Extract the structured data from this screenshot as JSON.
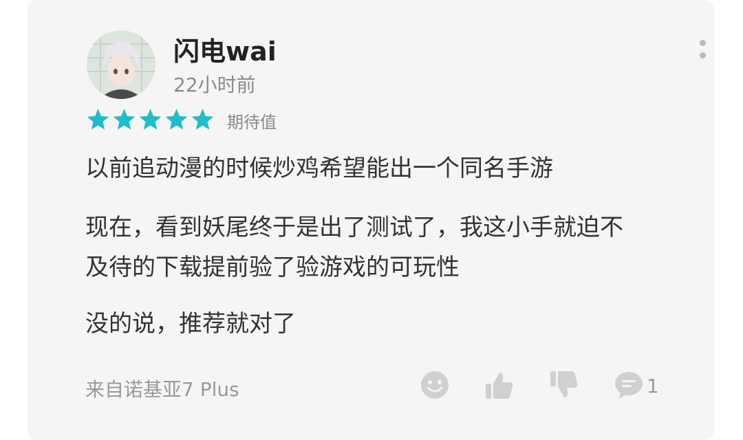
{
  "review": {
    "username": "闪电wai",
    "time": "22小时前",
    "rating": 5,
    "rating_max": 5,
    "rating_label": "期待值",
    "paragraphs": [
      [
        "以前追动漫的时候炒鸡希望能出一个同名手游"
      ],
      [
        "现在，看到妖尾终于是出了测试了，我这小手就迫不",
        "及待的下载提前验了验游戏的可玩性"
      ],
      [
        "没的说，推荐就对了"
      ]
    ],
    "device": "来自诺基亚7 Plus",
    "comment_count": "1"
  },
  "colors": {
    "star": "#1fbccc",
    "card_bg": "#f5f5f5",
    "icon_gray": "#d0d0d0"
  },
  "icons": [
    "more-vertical-icon",
    "emoji-icon",
    "thumbs-up-icon",
    "thumbs-down-icon",
    "comment-icon"
  ]
}
